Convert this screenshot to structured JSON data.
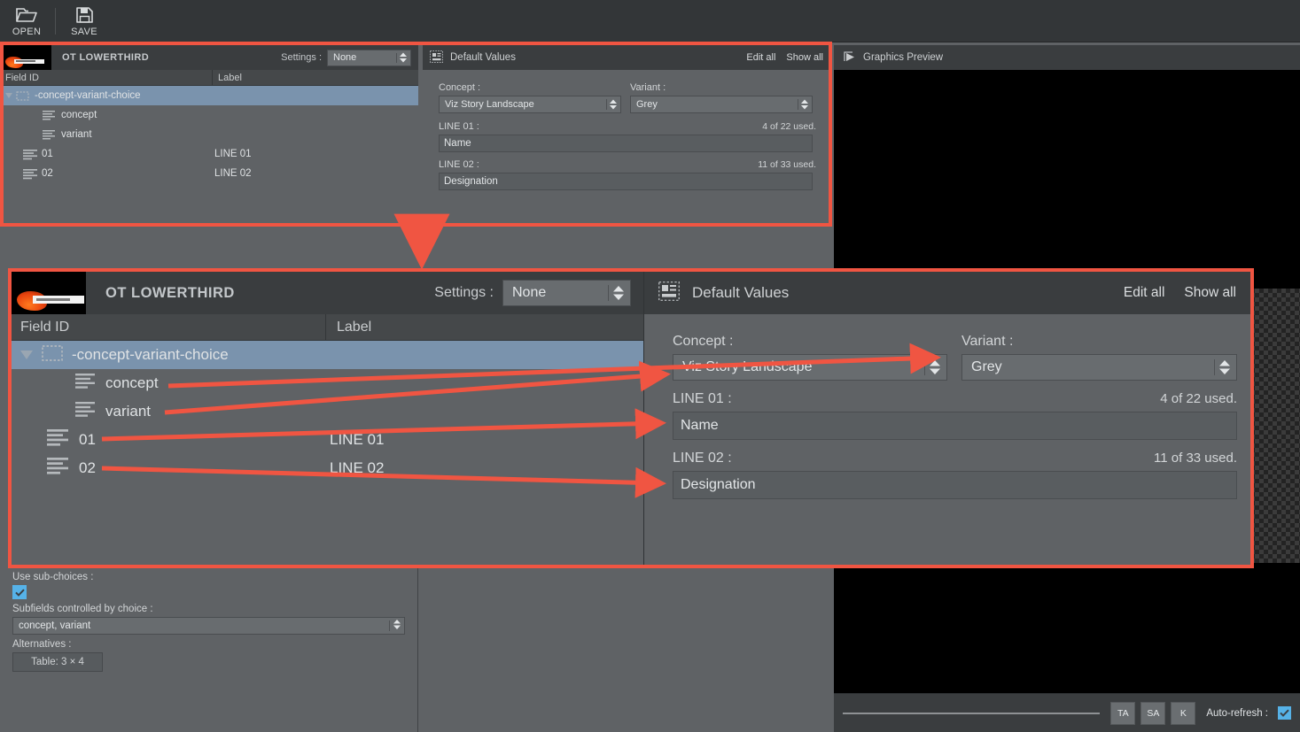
{
  "toolbar": {
    "buttons": [
      {
        "label": "OPEN",
        "icon": "folder-open-icon"
      },
      {
        "label": "SAVE",
        "icon": "floppy-disk-icon"
      }
    ]
  },
  "template_panel": {
    "title": "OT LOWERTHIRD",
    "settings_label": "Settings :",
    "settings_value": "None",
    "columns": {
      "field_id": "Field ID",
      "label": "Label"
    },
    "rows": [
      {
        "field_id": "-concept-variant-choice",
        "label": "",
        "icon": "dashed-box-icon",
        "selected": true,
        "expanded": true,
        "indent": 0
      },
      {
        "field_id": "concept",
        "label": "",
        "icon": "text-lines-icon",
        "selected": false,
        "indent": 2
      },
      {
        "field_id": "variant",
        "label": "",
        "icon": "text-lines-icon",
        "selected": false,
        "indent": 2
      },
      {
        "field_id": "01",
        "label": "LINE 01",
        "icon": "text-lines-icon",
        "selected": false,
        "indent": 1
      },
      {
        "field_id": "02",
        "label": "LINE 02",
        "icon": "text-lines-icon",
        "selected": false,
        "indent": 1
      }
    ]
  },
  "default_values": {
    "title": "Default Values",
    "icon": "default-values-icon",
    "edit_all": "Edit all",
    "show_all": "Show all",
    "concept": {
      "label": "Concept :",
      "value": "Viz Story Landscape"
    },
    "variant": {
      "label": "Variant :",
      "value": "Grey"
    },
    "line01": {
      "label": "LINE 01 :",
      "value": "Name",
      "counter": "4 of 22 used."
    },
    "line02": {
      "label": "LINE 02 :",
      "value": "Designation",
      "counter": "11 of 33 used."
    }
  },
  "preview": {
    "title": "Graphics Preview",
    "icon": "preview-play-icon",
    "buttons": [
      "TA",
      "SA",
      "K"
    ],
    "auto_refresh_label": "Auto-refresh :",
    "auto_refresh_checked": true
  },
  "properties": {
    "cut_value": "Concept",
    "use_subchoices_label": "Use sub-choices :",
    "use_subchoices_checked": true,
    "subfields_label": "Subfields controlled by choice :",
    "subfields_value": "concept, variant",
    "alternatives_label": "Alternatives :",
    "alternatives_button": "Table: 3 × 4"
  },
  "colors": {
    "accent_callout": "#f05542",
    "selection": "#7a93ad",
    "panel_bg": "#5f6265",
    "header_bg": "#3a3d3f",
    "toolbar_bg": "#333638",
    "checkbox": "#56b2e8"
  }
}
